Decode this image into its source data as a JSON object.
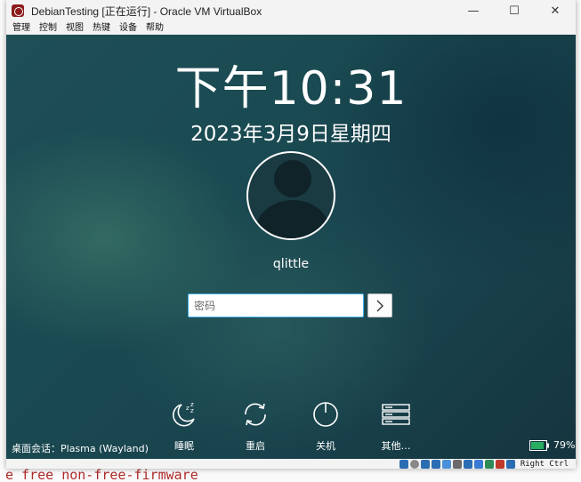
{
  "window": {
    "title": "DebianTesting [正在运行] - Oracle VM VirtualBox",
    "minimize_glyph": "—",
    "maximize_glyph": "☐",
    "close_glyph": "✕"
  },
  "menu": [
    "管理",
    "控制",
    "视图",
    "热键",
    "设备",
    "帮助"
  ],
  "lockscreen": {
    "time": "下午10:31",
    "date": "2023年3月9日星期四",
    "username": "qlittle",
    "password_placeholder": "密码",
    "session_label": "桌面会话：Plasma (Wayland)",
    "actions": {
      "sleep": "睡眠",
      "restart": "重启",
      "shutdown": "关机",
      "other": "其他…"
    },
    "battery_percent": "79%"
  },
  "statusbar": {
    "host_key": "Right Ctrl"
  },
  "host_background": {
    "bottom_text": "e free non-free-firmware"
  },
  "colors": {
    "accent": "#3daee9",
    "screen_bg": "#1a4a52"
  }
}
